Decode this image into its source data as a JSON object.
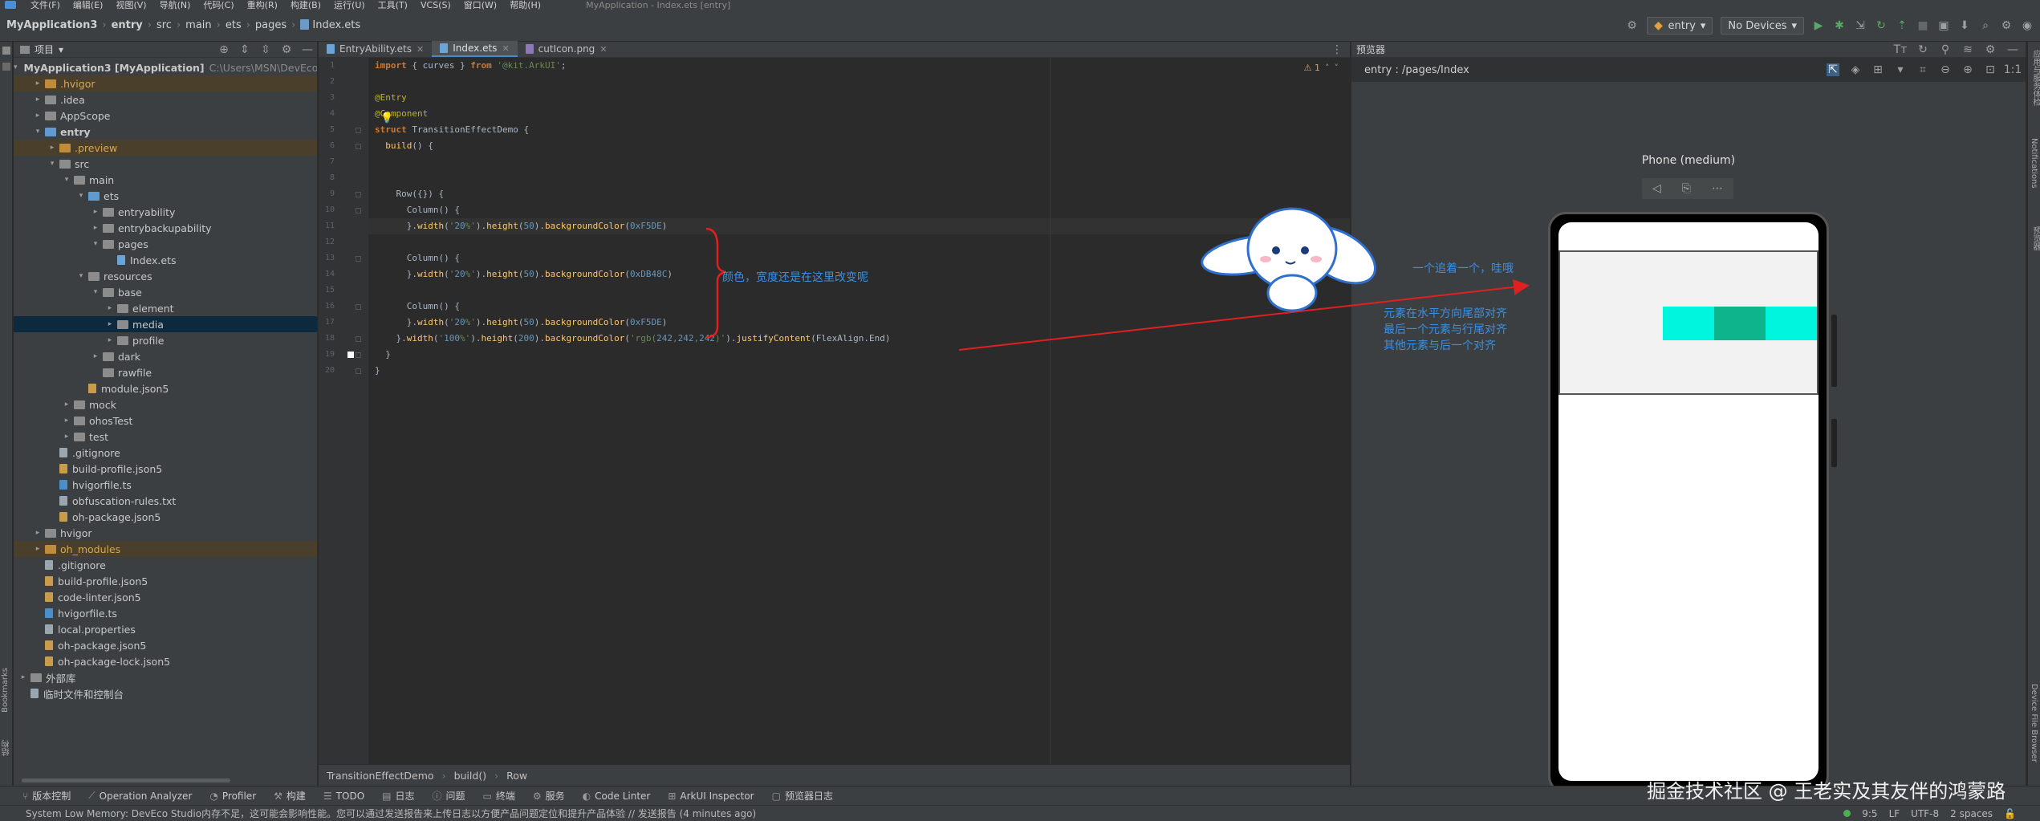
{
  "menubar": {
    "items": [
      "文件(F)",
      "编辑(E)",
      "视图(V)",
      "导航(N)",
      "代码(C)",
      "重构(R)",
      "构建(B)",
      "运行(U)",
      "工具(T)",
      "VCS(S)",
      "窗口(W)",
      "帮助(H)"
    ],
    "window_title": "MyApplication - Index.ets [entry]"
  },
  "navbar": {
    "crumbs": [
      "MyApplication3",
      "entry",
      "src",
      "main",
      "ets",
      "pages",
      "Index.ets"
    ],
    "run_config": "entry",
    "device": "No Devices"
  },
  "project": {
    "header": "项目",
    "tree": [
      {
        "label": "MyApplication3 [MyApplication]",
        "extra": "C:\\Users\\MSN\\DevEco",
        "indent": 0,
        "arrow": "▾",
        "icon": "folder-gray",
        "bold": true
      },
      {
        "label": ".hvigor",
        "indent": 1,
        "arrow": "▸",
        "icon": "folder-orange",
        "style": "excluded"
      },
      {
        "label": ".idea",
        "indent": 1,
        "arrow": "▸",
        "icon": "folder-gray"
      },
      {
        "label": "AppScope",
        "indent": 1,
        "arrow": "▸",
        "icon": "folder-gray"
      },
      {
        "label": "entry",
        "indent": 1,
        "arrow": "▾",
        "icon": "folder-blue",
        "bold": true
      },
      {
        "label": ".preview",
        "indent": 2,
        "arrow": "▸",
        "icon": "folder-orange",
        "style": "excluded"
      },
      {
        "label": "src",
        "indent": 2,
        "arrow": "▾",
        "icon": "folder-gray"
      },
      {
        "label": "main",
        "indent": 3,
        "arrow": "▾",
        "icon": "folder-gray"
      },
      {
        "label": "ets",
        "indent": 4,
        "arrow": "▾",
        "icon": "folder-blue"
      },
      {
        "label": "entryability",
        "indent": 5,
        "arrow": "▸",
        "icon": "folder-gray"
      },
      {
        "label": "entrybackupability",
        "indent": 5,
        "arrow": "▸",
        "icon": "folder-gray"
      },
      {
        "label": "pages",
        "indent": 5,
        "arrow": "▾",
        "icon": "folder-gray"
      },
      {
        "label": "Index.ets",
        "indent": 6,
        "arrow": "",
        "icon": "file-ets"
      },
      {
        "label": "resources",
        "indent": 4,
        "arrow": "▾",
        "icon": "folder-gray"
      },
      {
        "label": "base",
        "indent": 5,
        "arrow": "▾",
        "icon": "folder-gray"
      },
      {
        "label": "element",
        "indent": 6,
        "arrow": "▸",
        "icon": "folder-gray"
      },
      {
        "label": "media",
        "indent": 6,
        "arrow": "▸",
        "icon": "folder-gray",
        "style": "selected"
      },
      {
        "label": "profile",
        "indent": 6,
        "arrow": "▸",
        "icon": "folder-gray"
      },
      {
        "label": "dark",
        "indent": 5,
        "arrow": "▸",
        "icon": "folder-gray"
      },
      {
        "label": "rawfile",
        "indent": 5,
        "arrow": "",
        "icon": "folder-gray"
      },
      {
        "label": "module.json5",
        "indent": 4,
        "arrow": "",
        "icon": "file-json"
      },
      {
        "label": "mock",
        "indent": 3,
        "arrow": "▸",
        "icon": "folder-gray"
      },
      {
        "label": "ohosTest",
        "indent": 3,
        "arrow": "▸",
        "icon": "folder-gray"
      },
      {
        "label": "test",
        "indent": 3,
        "arrow": "▸",
        "icon": "folder-gray"
      },
      {
        "label": ".gitignore",
        "indent": 2,
        "arrow": "",
        "icon": "file"
      },
      {
        "label": "build-profile.json5",
        "indent": 2,
        "arrow": "",
        "icon": "file-json"
      },
      {
        "label": "hvigorfile.ts",
        "indent": 2,
        "arrow": "",
        "icon": "file-ts"
      },
      {
        "label": "obfuscation-rules.txt",
        "indent": 2,
        "arrow": "",
        "icon": "file"
      },
      {
        "label": "oh-package.json5",
        "indent": 2,
        "arrow": "",
        "icon": "file-json"
      },
      {
        "label": "hvigor",
        "indent": 1,
        "arrow": "▸",
        "icon": "folder-gray"
      },
      {
        "label": "oh_modules",
        "indent": 1,
        "arrow": "▸",
        "icon": "folder-orange",
        "style": "excluded"
      },
      {
        "label": ".gitignore",
        "indent": 1,
        "arrow": "",
        "icon": "file"
      },
      {
        "label": "build-profile.json5",
        "indent": 1,
        "arrow": "",
        "icon": "file-json"
      },
      {
        "label": "code-linter.json5",
        "indent": 1,
        "arrow": "",
        "icon": "file-json"
      },
      {
        "label": "hvigorfile.ts",
        "indent": 1,
        "arrow": "",
        "icon": "file-ts"
      },
      {
        "label": "local.properties",
        "indent": 1,
        "arrow": "",
        "icon": "file"
      },
      {
        "label": "oh-package.json5",
        "indent": 1,
        "arrow": "",
        "icon": "file-json"
      },
      {
        "label": "oh-package-lock.json5",
        "indent": 1,
        "arrow": "",
        "icon": "file-json"
      },
      {
        "label": "外部库",
        "indent": 0,
        "arrow": "▸",
        "icon": "folder-gray"
      },
      {
        "label": "临时文件和控制台",
        "indent": 0,
        "arrow": "",
        "icon": "file"
      }
    ]
  },
  "editor": {
    "tabs": [
      {
        "label": "EntryAbility.ets",
        "icon": "ets",
        "active": false
      },
      {
        "label": "Index.ets",
        "icon": "ets",
        "active": true
      },
      {
        "label": "cutIcon.png",
        "icon": "png",
        "active": false
      }
    ],
    "warnings": "⚠ 1",
    "line_numbers": [
      "1",
      "2",
      "3",
      "4",
      "5",
      "6",
      "7",
      "8",
      "9",
      "10",
      "11",
      "12",
      "13",
      "14",
      "15",
      "16",
      "17",
      "18",
      "19",
      "20"
    ],
    "lines": [
      "import { curves } from '@kit.ArkUI';",
      "",
      "@Entry",
      "@Component",
      "struct TransitionEffectDemo {",
      "  build() {",
      "",
      "",
      "    Row({}) {",
      "      Column() {",
      "      }.width('20%').height(50).backgroundColor(0xF5DE)",
      "",
      "      Column() {",
      "      }.width('20%').height(50).backgroundColor(0xDB48C)",
      "",
      "      Column() {",
      "      }.width('20%').height(50).backgroundColor(0xF5DE)",
      "    }.width('100%').height(200).backgroundColor('rgb(242,242,242)').justifyContent(FlexAlign.End)",
      "  }",
      "}"
    ],
    "annotation": "颜色，宽度还是在这里改变呢",
    "breadcrumb": [
      "TransitionEffectDemo",
      "build()",
      "Row"
    ]
  },
  "preview": {
    "header": "预览器",
    "path": "entry : /pages/Index",
    "device_name": "Phone (medium)",
    "note_top": "一个追着一个，哇哦",
    "note_lines": [
      "元素在水平方向尾部对齐",
      "最后一个元素与行尾对齐",
      "其他元素与后一个对齐"
    ],
    "colors": {
      "col1": "#00f5de",
      "col2": "#0db48c",
      "col3": "#00f5de",
      "row_bg": "#f2f2f2"
    }
  },
  "bottom_tools": [
    "版本控制",
    "Operation Analyzer",
    "Profiler",
    "构建",
    "TODO",
    "日志",
    "问题",
    "终端",
    "服务",
    "Code Linter",
    "ArkUI Inspector",
    "预览器日志"
  ],
  "status": {
    "message": "System Low Memory: DevEco Studio内存不足，这可能会影响性能。您可以通过发送报告来上传日志以方便产品问题定位和提升产品体验 // 发送报告 (4 minutes ago)",
    "position": "9:5",
    "line_sep": "LF",
    "encoding": "UTF-8",
    "indent": "2 spaces"
  },
  "watermark": "掘金技术社区 @ 王老实及其友伴的鸿蒙路"
}
